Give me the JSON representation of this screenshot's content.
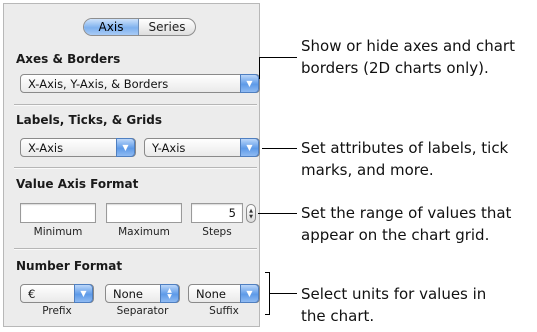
{
  "tabs": {
    "axis": "Axis",
    "series": "Series"
  },
  "axes_borders": {
    "title": "Axes & Borders",
    "popup_value": "X-Axis, Y-Axis, & Borders"
  },
  "labels_ticks_grids": {
    "title": "Labels, Ticks, & Grids",
    "x_popup_value": "X-Axis",
    "y_popup_value": "Y-Axis"
  },
  "value_axis_format": {
    "title": "Value Axis Format",
    "minimum_value": "",
    "maximum_value": "",
    "steps_value": "5",
    "minimum_label": "Minimum",
    "maximum_label": "Maximum",
    "steps_label": "Steps"
  },
  "number_format": {
    "title": "Number Format",
    "prefix_value": "€",
    "separator_value": "None",
    "suffix_value": "None",
    "prefix_label": "Prefix",
    "separator_label": "Separator",
    "suffix_label": "Suffix"
  },
  "callouts": {
    "axes_line1": "Show or hide axes and chart",
    "axes_line2": "borders (2D charts only).",
    "labels_line1": "Set attributes of labels, tick",
    "labels_line2": "marks, and more.",
    "range_line1": "Set the range of values that",
    "range_line2": "appear on the chart grid.",
    "units_line1": "Select units for values in",
    "units_line2": "the chart."
  },
  "icons": {
    "popup_arrow": "chevron-down-icon",
    "stepper": "stepper-arrows-icon"
  },
  "colors": {
    "selected_tab": "#7eb1ee",
    "popup_arrow": "#5d9ae8",
    "panel_background": "#ececec"
  }
}
